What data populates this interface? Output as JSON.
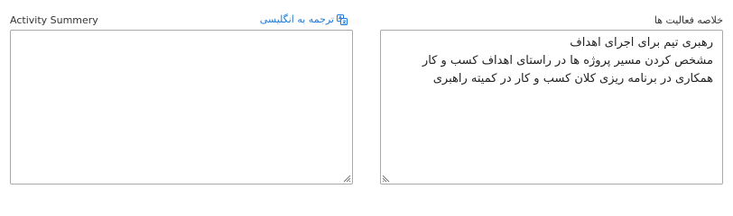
{
  "left_field": {
    "label": "Activity Summery",
    "translate_label": "ترجمه به انگلیسی",
    "value": ""
  },
  "right_field": {
    "label": "خلاصه فعالیت ها",
    "lines": [
      "رهبری تیم برای اجرای اهداف",
      "مشخص کردن مسیر پروژه ها در راستای اهداف کسب و کار",
      "همکاری در برنامه ریزی کلان کسب و کار در کمیته راهبری"
    ]
  },
  "colors": {
    "link": "#1e7ad6",
    "border": "#a9a9a9",
    "text": "#222222"
  },
  "icons": {
    "translate": "translate-icon",
    "resize": "resize-grip-icon"
  }
}
